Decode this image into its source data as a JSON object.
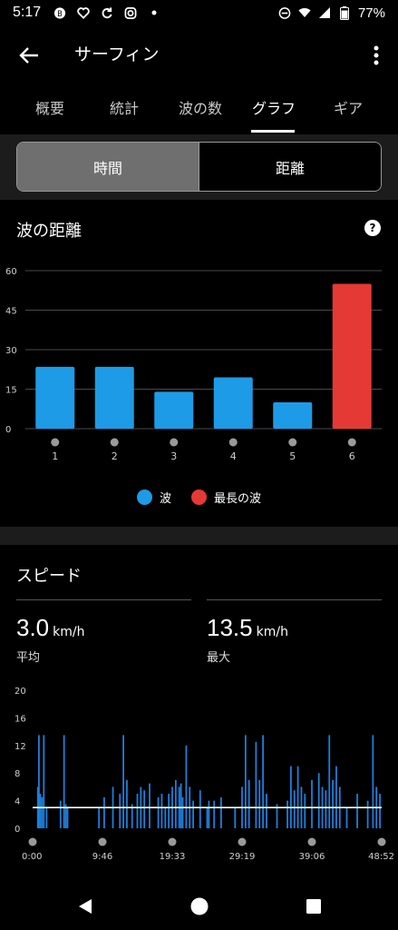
{
  "status_bar": {
    "time": "5:17",
    "battery": "77%"
  },
  "app_bar": {
    "title": "サーフィン"
  },
  "tabs": [
    {
      "label": "概要"
    },
    {
      "label": "統計"
    },
    {
      "label": "波の数"
    },
    {
      "label": "グラフ"
    },
    {
      "label": "ギア"
    }
  ],
  "active_tab": "グラフ",
  "toggle": {
    "time_label": "時間",
    "distance_label": "距離",
    "selected": "時間"
  },
  "wave_distance": {
    "title": "波の距離",
    "legend": {
      "wave": "波",
      "longest": "最長の波"
    },
    "colors": {
      "wave": "#1e9be6",
      "longest": "#e53935"
    }
  },
  "speed": {
    "title": "スピード",
    "avg_value": "3.0",
    "avg_unit": "km/h",
    "avg_label": "平均",
    "max_value": "13.5",
    "max_unit": "km/h",
    "max_label": "最大"
  },
  "chart_data": [
    {
      "type": "bar",
      "categories": [
        "1",
        "2",
        "3",
        "4",
        "5",
        "6"
      ],
      "values": [
        23.5,
        23.5,
        14,
        19.5,
        10,
        55
      ],
      "highlight_index": 5,
      "ylim": [
        0,
        60
      ],
      "yticks": [
        "0",
        "15",
        "30",
        "45",
        "60"
      ],
      "grid": true
    },
    {
      "type": "area",
      "ylim": [
        0,
        20
      ],
      "yticks": [
        "0",
        "4",
        "8",
        "12",
        "16",
        "20"
      ],
      "xticks": [
        "0:00",
        "9:46",
        "19:33",
        "29:19",
        "39:06",
        "48:52"
      ],
      "average_line": 3.0,
      "spikes": [
        [
          0.015,
          6
        ],
        [
          0.018,
          13.5
        ],
        [
          0.022,
          5
        ],
        [
          0.027,
          4.5
        ],
        [
          0.032,
          13.5
        ],
        [
          0.04,
          3
        ],
        [
          0.08,
          4
        ],
        [
          0.09,
          13.5
        ],
        [
          0.095,
          3.5
        ],
        [
          0.1,
          3
        ],
        [
          0.19,
          3
        ],
        [
          0.205,
          4.5
        ],
        [
          0.23,
          6
        ],
        [
          0.25,
          5
        ],
        [
          0.26,
          13.5
        ],
        [
          0.27,
          7
        ],
        [
          0.285,
          3.5
        ],
        [
          0.3,
          5
        ],
        [
          0.31,
          6
        ],
        [
          0.32,
          5.5
        ],
        [
          0.335,
          6.5
        ],
        [
          0.36,
          4.5
        ],
        [
          0.37,
          5
        ],
        [
          0.38,
          3
        ],
        [
          0.39,
          5
        ],
        [
          0.4,
          6
        ],
        [
          0.41,
          7
        ],
        [
          0.42,
          6
        ],
        [
          0.425,
          6.5
        ],
        [
          0.43,
          4.5
        ],
        [
          0.44,
          12
        ],
        [
          0.45,
          6
        ],
        [
          0.46,
          4
        ],
        [
          0.48,
          5.5
        ],
        [
          0.5,
          3
        ],
        [
          0.505,
          4
        ],
        [
          0.52,
          4
        ],
        [
          0.54,
          4.5
        ],
        [
          0.58,
          3
        ],
        [
          0.6,
          6
        ],
        [
          0.61,
          13.5
        ],
        [
          0.62,
          7
        ],
        [
          0.64,
          12.5
        ],
        [
          0.65,
          7
        ],
        [
          0.66,
          13.5
        ],
        [
          0.67,
          5
        ],
        [
          0.7,
          3.5
        ],
        [
          0.73,
          4
        ],
        [
          0.74,
          9
        ],
        [
          0.75,
          5.5
        ],
        [
          0.76,
          9
        ],
        [
          0.77,
          6
        ],
        [
          0.78,
          5
        ],
        [
          0.8,
          7
        ],
        [
          0.82,
          8
        ],
        [
          0.83,
          6
        ],
        [
          0.84,
          5.5
        ],
        [
          0.85,
          13.5
        ],
        [
          0.86,
          7
        ],
        [
          0.87,
          9
        ],
        [
          0.88,
          6
        ],
        [
          0.9,
          3
        ],
        [
          0.93,
          5
        ],
        [
          0.96,
          4
        ],
        [
          0.975,
          13.5
        ],
        [
          0.985,
          6
        ],
        [
          0.995,
          5
        ]
      ]
    }
  ]
}
